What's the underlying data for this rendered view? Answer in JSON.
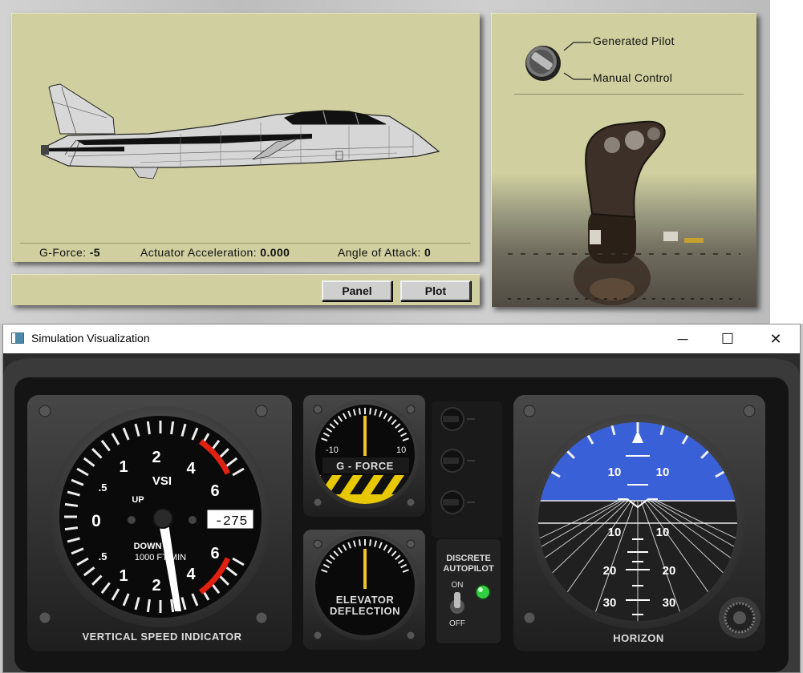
{
  "readouts": {
    "g_force_label": "G-Force:",
    "g_force_value": "-5",
    "actuator_label": "Actuator Acceleration:",
    "actuator_value": "0.000",
    "aoa_label": "Angle of Attack:",
    "aoa_value": "0"
  },
  "buttons": {
    "panel": "Panel",
    "plot": "Plot"
  },
  "pilot_mode": {
    "options": [
      "Generated Pilot",
      "Manual Control"
    ],
    "selected": "Generated Pilot"
  },
  "window": {
    "title": "Simulation Visualization",
    "minimize": "─",
    "maximize": "☐",
    "close": "✕"
  },
  "vsi": {
    "label": "VERTICAL SPEED INDICATOR",
    "center": "VSI",
    "up": "UP",
    "down": "DOWN",
    "units": "1000 FT/MIN",
    "readout": "-275",
    "ticks_upper": [
      ".5",
      "1",
      "2",
      "4",
      "6"
    ],
    "ticks_lower": [
      ".5",
      "1",
      "2",
      "4",
      "6"
    ],
    "zero": "0"
  },
  "g_force": {
    "label": "G - FORCE",
    "min": "-10",
    "max": "10",
    "value": 0
  },
  "elevator": {
    "label_line1": "ELEVATOR",
    "label_line2": "DEFLECTION",
    "value": 0
  },
  "autopilot": {
    "label_line1": "DISCRETE",
    "label_line2": "AUTOPILOT",
    "on": "ON",
    "off": "OFF",
    "state": "ON"
  },
  "horizon": {
    "label": "HORIZON",
    "pitch_marks": [
      {
        "left": "10",
        "right": "10"
      },
      {
        "left": "10",
        "right": "10"
      },
      {
        "left": "20",
        "right": "20"
      },
      {
        "left": "30",
        "right": "30"
      }
    ]
  },
  "colors": {
    "panel": "#cfcf9f",
    "sky": "#3a60d8",
    "needle": "#f0c030",
    "led": "#30d040",
    "redline": "#e02010"
  }
}
